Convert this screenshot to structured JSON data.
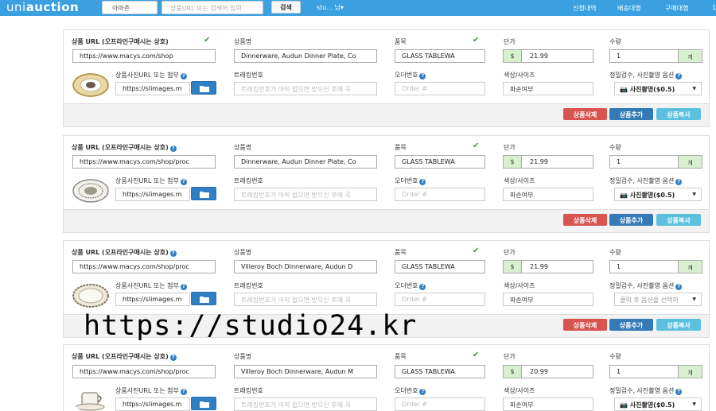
{
  "navbar": {
    "logo_light": "uni",
    "logo_bold": "auction",
    "site_select": "아마존",
    "search_placeholder": "상품URL 또는 검색어 입력",
    "search_button": "검색",
    "user": "stu... 님▾",
    "links": [
      "신청내역",
      "배송대행",
      "구매대행",
      "1"
    ]
  },
  "labels": {
    "product_url": "상품 URL (오프라인구매시는 상호)",
    "product_name": "상품명",
    "category": "품목",
    "unit_price": "단가",
    "quantity": "수량",
    "image_url": "상품사진URL 또는 첨부",
    "tracking": "트래킹번호",
    "order_no": "오더번호",
    "color_size": "색상/사이즈",
    "inspection": "정밀검수, 사진촬영 옵션"
  },
  "placeholders": {
    "tracking": "트래킹번호가 아직 없으면 받으신 후에 꼭",
    "order_no": "Order #",
    "option": "클릭 후 옵션을 선택하"
  },
  "currency": "$",
  "qty_unit": "개",
  "buttons": {
    "delete": "상품삭제",
    "add": "상품추가",
    "copy": "상품복사"
  },
  "items": [
    {
      "url": "https://www.macys.com/shop",
      "name": "Dinnerware, Audun Dinner Plate, Co",
      "category": "GLASS TABLEWA",
      "price": "21.99",
      "qty": "1",
      "image_url": "https://slimages.m",
      "color": "파손여부",
      "option": "📷 사진촬영($0.5)"
    },
    {
      "url": "https://www.macys.com/shop/proc",
      "name": "Dinnerware, Audun Dinner Plate, Co",
      "category": "GLASS TABLEWA",
      "price": "21.99",
      "qty": "1",
      "image_url": "https://slimages.m",
      "color": "파손여부",
      "option": "📷 사진촬영($0.5)"
    },
    {
      "url": "https://www.macys.com/shop/proc",
      "name": "Villeroy  Boch Dinnerware, Audun D",
      "category": "GLASS TABLEWA",
      "price": "21.99",
      "qty": "1",
      "image_url": "https://slimages.m",
      "color": "파손여부",
      "option": ""
    },
    {
      "url": "https://www.macys.com/shop/proc",
      "name": "Villeroy  Boch Dinnerware, Audun M",
      "category": "GLASS TABLEWA",
      "price": "20.99",
      "qty": "1",
      "image_url": "https://slimages.m",
      "color": "파손여부",
      "option": "📷 사진촬영($0.5)"
    }
  ],
  "watermark": "https://studio24.kr",
  "colors": {
    "navbar": "#3aa0e0",
    "delete": "#d9534f",
    "add": "#337ab7",
    "copy": "#5bc0de",
    "addon": "#d8f0d0"
  }
}
